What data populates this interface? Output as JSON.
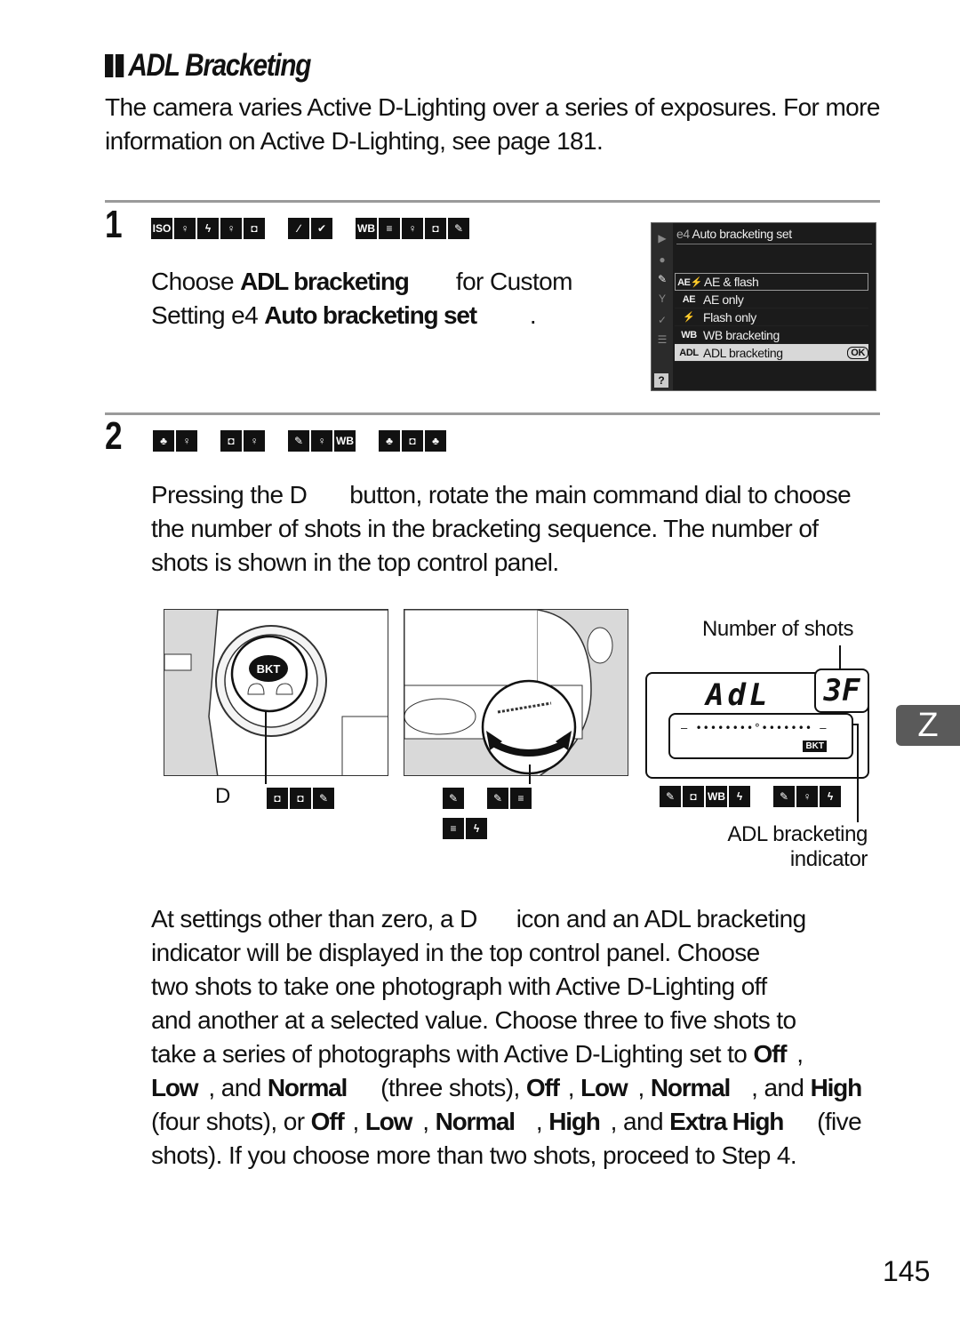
{
  "section": {
    "title": "ADL Bracketing",
    "intro": "The camera varies Active D-Lighting over a series of exposures.  For more information on Active D-Lighting, see page 181."
  },
  "step1": {
    "number": "1",
    "glyph_groups": [
      [
        "ISO",
        "mic-icon",
        "flash-icon",
        "mic-icon",
        "camera-icon"
      ],
      [
        "clip-icon",
        "check-icon"
      ],
      [
        "WB",
        "stack-icon",
        "mic-icon",
        "camera-icon",
        "pen-icon"
      ]
    ],
    "text_parts": {
      "a": "Choose ",
      "b": "ADL bracketing",
      "c": " for Custom",
      "d": "Setting e4 ",
      "e": "Auto bracketing set",
      "f": "."
    },
    "menu": {
      "code": "e4",
      "title": "Auto bracketing set",
      "items": [
        {
          "icon": "AE⚡",
          "label": "AE & flash"
        },
        {
          "icon": "AE",
          "label": "AE only"
        },
        {
          "icon": "⚡",
          "label": "Flash only"
        },
        {
          "icon": "WB",
          "label": "WB bracketing"
        },
        {
          "icon": "ADL",
          "label": "ADL bracketing",
          "ok": "OK"
        }
      ],
      "help": "?"
    }
  },
  "step2": {
    "number": "2",
    "glyph_groups": [
      [
        "sprout-icon",
        "mic-icon"
      ],
      [
        "camera-icon",
        "mic-icon"
      ],
      [
        "pen-icon",
        "mic-icon",
        "WB"
      ],
      [
        "sprout-icon",
        "camera-icon",
        "sprout-icon"
      ]
    ],
    "text": {
      "a": "Pressing the D",
      "b": "button, rotate the main command dial to choose the number of shots in the bracketing sequence.  The number of shots is shown in the top control panel."
    },
    "figure": {
      "button_label": "BKT",
      "button_caption": "D",
      "lcd_text": "AdL",
      "lcd_shots": "3F",
      "lcd_scale": "– ••••••••°••••••• –",
      "lcd_bkt": "BKT",
      "label_number_of_shots": "Number of shots",
      "label_adl_indicator_1": "ADL bracketing",
      "label_adl_indicator_2": "indicator"
    },
    "para2": {
      "l1a": "At settings other than zero, a D",
      "l1b": "icon and an ADL bracketing",
      "l2": "indicator will be displayed in the top control panel.  Choose",
      "l3": "two shots to take one photograph with Active D-Lighting off",
      "l4": "and another at a selected value.  Choose three to five shots to",
      "l5a": "take a series of photographs with Active D-Lighting set to ",
      "off": "Off",
      "low": "Low",
      "normal": "Normal",
      "high": "High",
      "extra_high": "Extra High",
      "and": ", and ",
      "three_shots": "(three shots), ",
      "four_shots": "(four shots), or ",
      "five": "(five",
      "l8": "shots). If you choose more than two shots, proceed to Step 4."
    }
  },
  "side_tab": "Z",
  "page_number": "145"
}
